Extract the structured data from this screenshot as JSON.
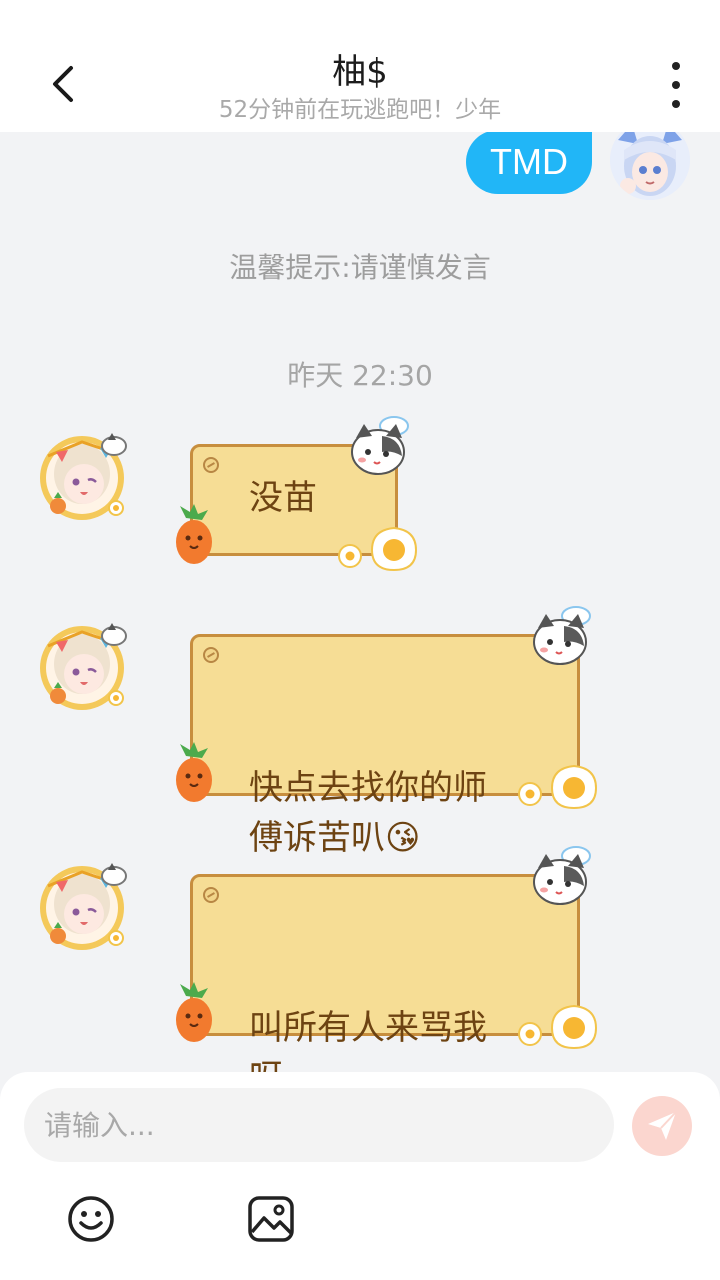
{
  "header": {
    "title": "柚$",
    "subtitle": "52分钟前在玩逃跑吧！少年"
  },
  "chat": {
    "outgoing": [
      {
        "text": "TMD"
      }
    ],
    "tip": "温馨提示:请谨慎发言",
    "timestamp": "昨天 22:30",
    "incoming": [
      {
        "text": "没苗"
      },
      {
        "text": "快点去找你的师\n傅诉苦叭😘"
      },
      {
        "text": "叫所有人来骂我\n呀"
      }
    ]
  },
  "input": {
    "placeholder": "请输入..."
  },
  "toolbar": {
    "icons": [
      "emoji-icon",
      "image-icon"
    ]
  },
  "colors": {
    "accent_blue": "#21b6f7",
    "bubble_fill": "#f6dd95",
    "bubble_border": "#c78e3e",
    "bubble_text": "#6d4312",
    "send_button_disabled": "#fbd6cf"
  }
}
